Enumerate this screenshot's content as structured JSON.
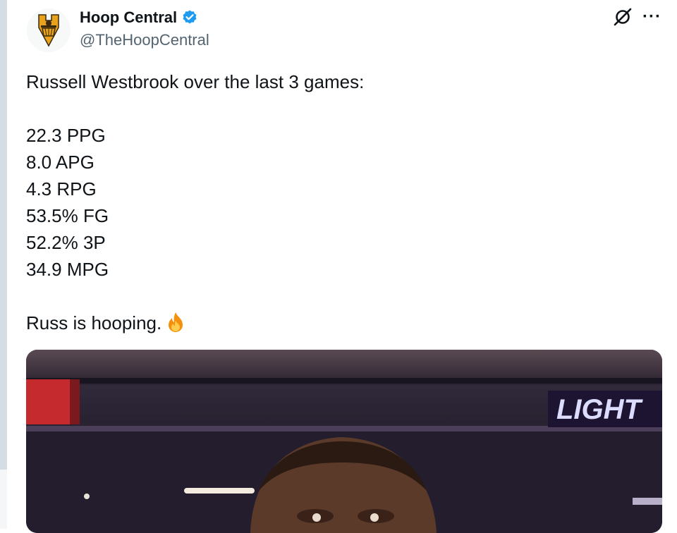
{
  "author": {
    "name": "Hoop Central",
    "handle": "@TheHoopCentral",
    "verified": true,
    "avatar_icon": "hoop-central-shield-logo"
  },
  "actions": {
    "grok_icon": "grok-icon",
    "more_label": "···"
  },
  "tweet": {
    "intro": "Russell Westbrook over the last 3 games:",
    "stats": [
      "22.3 PPG",
      "8.0 APG",
      "4.3 RPG",
      "53.5% FG",
      "52.2% 3P",
      "34.9 MPG"
    ],
    "closing": "Russ is hooping.",
    "emoji": "fire-emoji"
  },
  "media": {
    "arena_sign": "LIGHT"
  },
  "colors": {
    "text": "#0f1419",
    "secondary": "#536471",
    "verified": "#1d9bf0"
  }
}
